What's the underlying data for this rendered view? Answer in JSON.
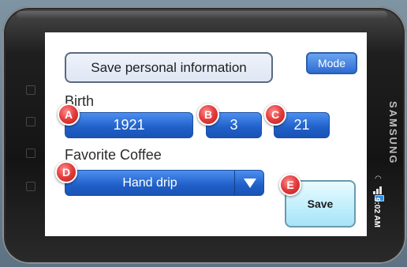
{
  "screen": {
    "header": {
      "title_button": "Save personal information",
      "mode_button": "Mode"
    },
    "birth": {
      "label": "Birth",
      "year": "1921",
      "month": "3",
      "day": "21"
    },
    "coffee": {
      "label": "Favorite Coffee",
      "selected": "Hand drip"
    },
    "save_button": "Save",
    "markers": {
      "a": "A",
      "b": "B",
      "c": "C",
      "d": "D",
      "e": "E"
    }
  },
  "device": {
    "brand": "SAMSUNG",
    "status_time": "9:02 AM"
  },
  "colors": {
    "field_blue": "#2e6bd3",
    "marker_red": "#e23b3b",
    "save_cyan": "#bfeefc"
  }
}
